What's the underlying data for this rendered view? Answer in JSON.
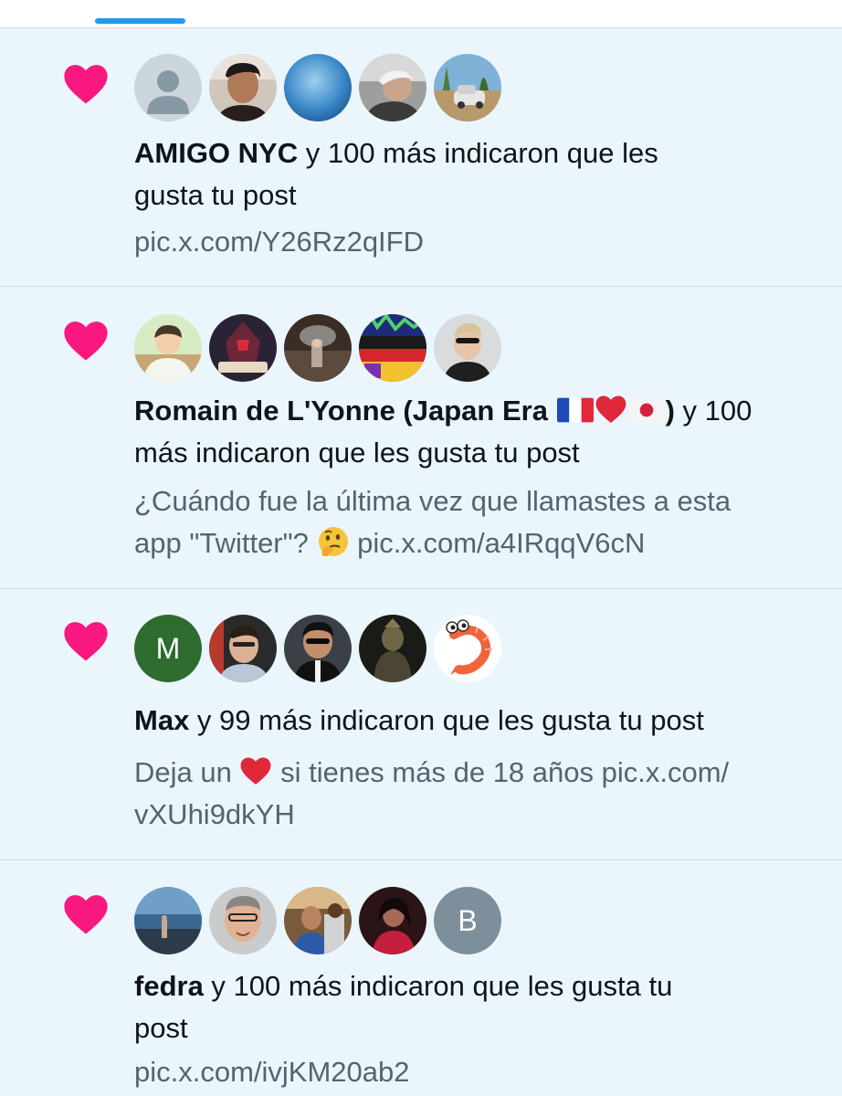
{
  "colors": {
    "background": "#eaf6fc",
    "accent": "#1d9bf0",
    "like": "#f91880",
    "primary_text": "#0f1419",
    "secondary_text": "#536471"
  },
  "notifications": [
    {
      "icon": "heart-icon",
      "avatars": [
        "default-avatar",
        "photo-avatar",
        "photo-avatar",
        "photo-avatar",
        "photo-avatar"
      ],
      "name": "AMIGO NYC",
      "action_line1": " y 100 más indicaron que les",
      "action_line2": "gusta tu post",
      "snippet": "pic.x.com/Y26Rz2qIFD"
    },
    {
      "icon": "heart-icon",
      "avatars": [
        "photo-avatar",
        "photo-avatar",
        "photo-avatar",
        "photo-avatar",
        "photo-avatar"
      ],
      "name": "Romain de L'Yonne (Japan Era ",
      "name_end": ")",
      "action_line1": " y 100",
      "action_line2": "más indicaron que les gusta tu post",
      "snippet_line1": "¿Cuándo fue la última vez que llamastes a esta",
      "snippet_line2a": "app \"Twitter\"? ",
      "snippet_line2b": " pic.x.com/a4IRqqV6cN"
    },
    {
      "icon": "heart-icon",
      "avatars": [
        "letter-avatar",
        "photo-avatar",
        "photo-avatar",
        "photo-avatar",
        "shrimp-avatar"
      ],
      "avatar_letter": "M",
      "name": "Max",
      "action_line1": " y 99 más indicaron que les gusta tu post",
      "snippet_line1a": "Deja un ",
      "snippet_line1b": " si tienes más de 18 años pic.x.com/",
      "snippet_line2": "vXUhi9dkYH"
    },
    {
      "icon": "heart-icon",
      "avatars": [
        "photo-avatar",
        "photo-avatar",
        "photo-avatar",
        "photo-avatar",
        "letter-avatar"
      ],
      "avatar_letter": "B",
      "name": "fedra",
      "action_line1": " y 100 más indicaron que les gusta tu",
      "action_line2": "post",
      "snippet": "pic.x.com/ivjKM20ab2"
    }
  ]
}
